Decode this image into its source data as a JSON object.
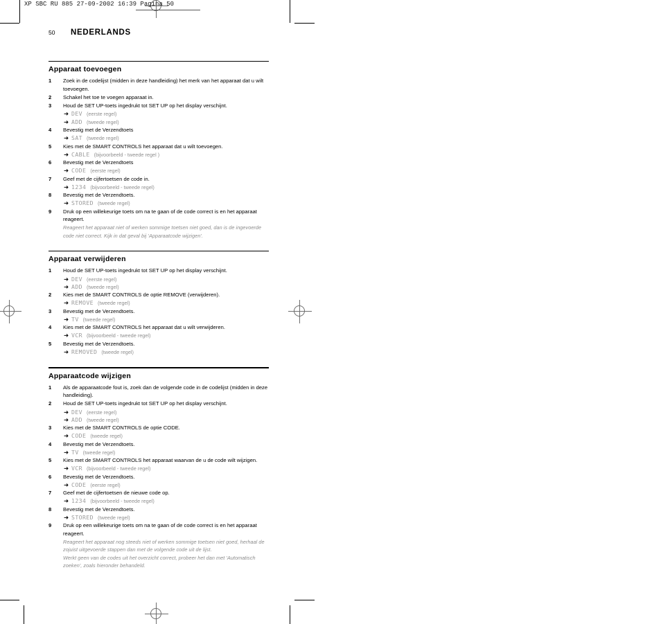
{
  "film_header": {
    "text": "XP SBC RU 885  27-09-2002 16:39  Pagina 50"
  },
  "page_head": {
    "page_number": "50",
    "title": "NEDERLANDS"
  },
  "sections": [
    {
      "title": "Apparaat toevoegen",
      "steps": [
        {
          "num": "1",
          "text": "Zoek in de codelijst (midden in deze handleiding) het merk van het apparaat dat u wilt toevoegen.",
          "lcd": []
        },
        {
          "num": "2",
          "text": "Schakel het toe te voegen apparaat in.",
          "lcd": []
        },
        {
          "num": "3",
          "text": "Houd de SET UP-toets ingedrukt tot SET UP op het display verschijnt.",
          "lcd": [
            {
              "arrow": "➜",
              "code": "DEV",
              "note": "(eerste regel)"
            },
            {
              "arrow": "➜",
              "code": "ADD",
              "note": "(tweede regel)"
            }
          ]
        },
        {
          "num": "4",
          "text": "Bevestig met de Verzendtoets",
          "lcd": [
            {
              "arrow": "➜",
              "code": "SAT",
              "note": "(tweede regel)"
            }
          ]
        },
        {
          "num": "5",
          "text": "Kies met de SMART CONTROLS het apparaat dat u wilt toevoegen.",
          "lcd": [
            {
              "arrow": "➜",
              "code": "CABLE",
              "note": "(bijvoorbeeld - tweede regel )"
            }
          ]
        },
        {
          "num": "6",
          "text": "Bevestig met de Verzendtoets",
          "lcd": [
            {
              "arrow": "➜",
              "code": "CODE",
              "note": "(eerste regel)"
            }
          ]
        },
        {
          "num": "7",
          "text": "Geef met de cijfertoetsen de code in.",
          "lcd": [
            {
              "arrow": "➜",
              "code": "1234",
              "note": "(bijvoorbeeld - tweede regel)"
            }
          ]
        },
        {
          "num": "8",
          "text": "Bevestig met de Verzendtoets.",
          "lcd": [
            {
              "arrow": "➜",
              "code": "STORED",
              "note": "(tweede regel)"
            }
          ]
        },
        {
          "num": "9",
          "text": "Druk op een willekeurige toets om na te gaan of de code correct is en het apparaat reageert.",
          "lcd": [],
          "remarks": [
            "Reageert het apparaat niet of werken sommige toetsen niet goed, dan is de ingevoerde code niet correct. Kijk in dat geval bij 'Apparaatcode wijzigen'."
          ]
        }
      ]
    },
    {
      "title": "Apparaat verwijderen",
      "steps": [
        {
          "num": "1",
          "text": "Houd de SET UP-toets ingedrukt tot SET UP op het display verschijnt.",
          "lcd": [
            {
              "arrow": "➜",
              "code": "DEV",
              "note": "(eerste regel)"
            },
            {
              "arrow": "➜",
              "code": "ADD",
              "note": "(tweede regel)"
            }
          ]
        },
        {
          "num": "2",
          "text": "Kies met de SMART CONTROLS de optie REMOVE (verwijderen).",
          "lcd": [
            {
              "arrow": "➜",
              "code": "REMOVE",
              "note": "(tweede regel)"
            }
          ]
        },
        {
          "num": "3",
          "text": "Bevestig met de Verzendtoets.",
          "lcd": [
            {
              "arrow": "➜",
              "code": "TV",
              "note": "(tweede regel)"
            }
          ]
        },
        {
          "num": "4",
          "text": "Kies met de SMART CONTROLS het apparaat dat u wilt verwijderen.",
          "lcd": [
            {
              "arrow": "➜",
              "code": "VCR",
              "note": "(bijvoorbeeld - tweede regel)"
            }
          ]
        },
        {
          "num": "5",
          "text": "Bevestig met de Verzendtoets.",
          "lcd": [
            {
              "arrow": "➜",
              "code": "REMOVED",
              "note": "(tweede regel)"
            }
          ]
        }
      ]
    },
    {
      "title": "Apparaatcode wijzigen",
      "steps": [
        {
          "num": "1",
          "text": "Als de apparaatcode fout is, zoek dan de volgende code in de codelijst (midden in deze handleiding).",
          "lcd": []
        },
        {
          "num": "2",
          "text": "Houd de SET UP-toets ingedrukt tot SET UP op het display verschijnt.",
          "lcd": [
            {
              "arrow": "➜",
              "code": "DEV",
              "note": "(eerste regel)"
            },
            {
              "arrow": "➜",
              "code": "ADD",
              "note": "(tweede regel)"
            }
          ]
        },
        {
          "num": "3",
          "text": "Kies met de SMART CONTROLS de optie CODE.",
          "lcd": [
            {
              "arrow": "➜",
              "code": "CODE",
              "note": "(tweede regel)"
            }
          ]
        },
        {
          "num": "4",
          "text": "Bevestig met de Verzendtoets.",
          "lcd": [
            {
              "arrow": "➜",
              "code": "TV",
              "note": "(tweede regel)"
            }
          ]
        },
        {
          "num": "5",
          "text": "Kies met de SMART CONTROLS het apparaat waarvan de u de code wilt wijzigen.",
          "lcd": [
            {
              "arrow": "➜",
              "code": "VCR",
              "note": "(bijvoorbeeld - tweede regel)"
            }
          ]
        },
        {
          "num": "6",
          "text": "Bevestig met de Verzendtoets.",
          "lcd": [
            {
              "arrow": "➜",
              "code": "CODE",
              "note": "(eerste regel)"
            }
          ]
        },
        {
          "num": "7",
          "text": "Geef met de cijfertoetsen de nieuwe code op.",
          "lcd": [
            {
              "arrow": "➜",
              "code": "1234",
              "note": "(bijvoorbeeld - tweede regel)"
            }
          ]
        },
        {
          "num": "8",
          "text": "Bevestig met de Verzendtoets.",
          "lcd": [
            {
              "arrow": "➜",
              "code": "STORED",
              "note": "(tweede regel)"
            }
          ]
        },
        {
          "num": "9",
          "text": "Druk op een willekeurige toets om na te gaan of de code correct is en het apparaat reageert.",
          "lcd": [],
          "remarks": [
            "Reageert het apparaat nog steeds niet of werken sommige toetsen niet goed, herhaal de zojuist uitgevoerde stappen dan met de volgende code uit de lijst.",
            "Werkt geen van de codes uit het overzicht correct, probeer het dan met 'Automatisch zoeken', zoals hieronder behandeld."
          ]
        }
      ]
    }
  ]
}
